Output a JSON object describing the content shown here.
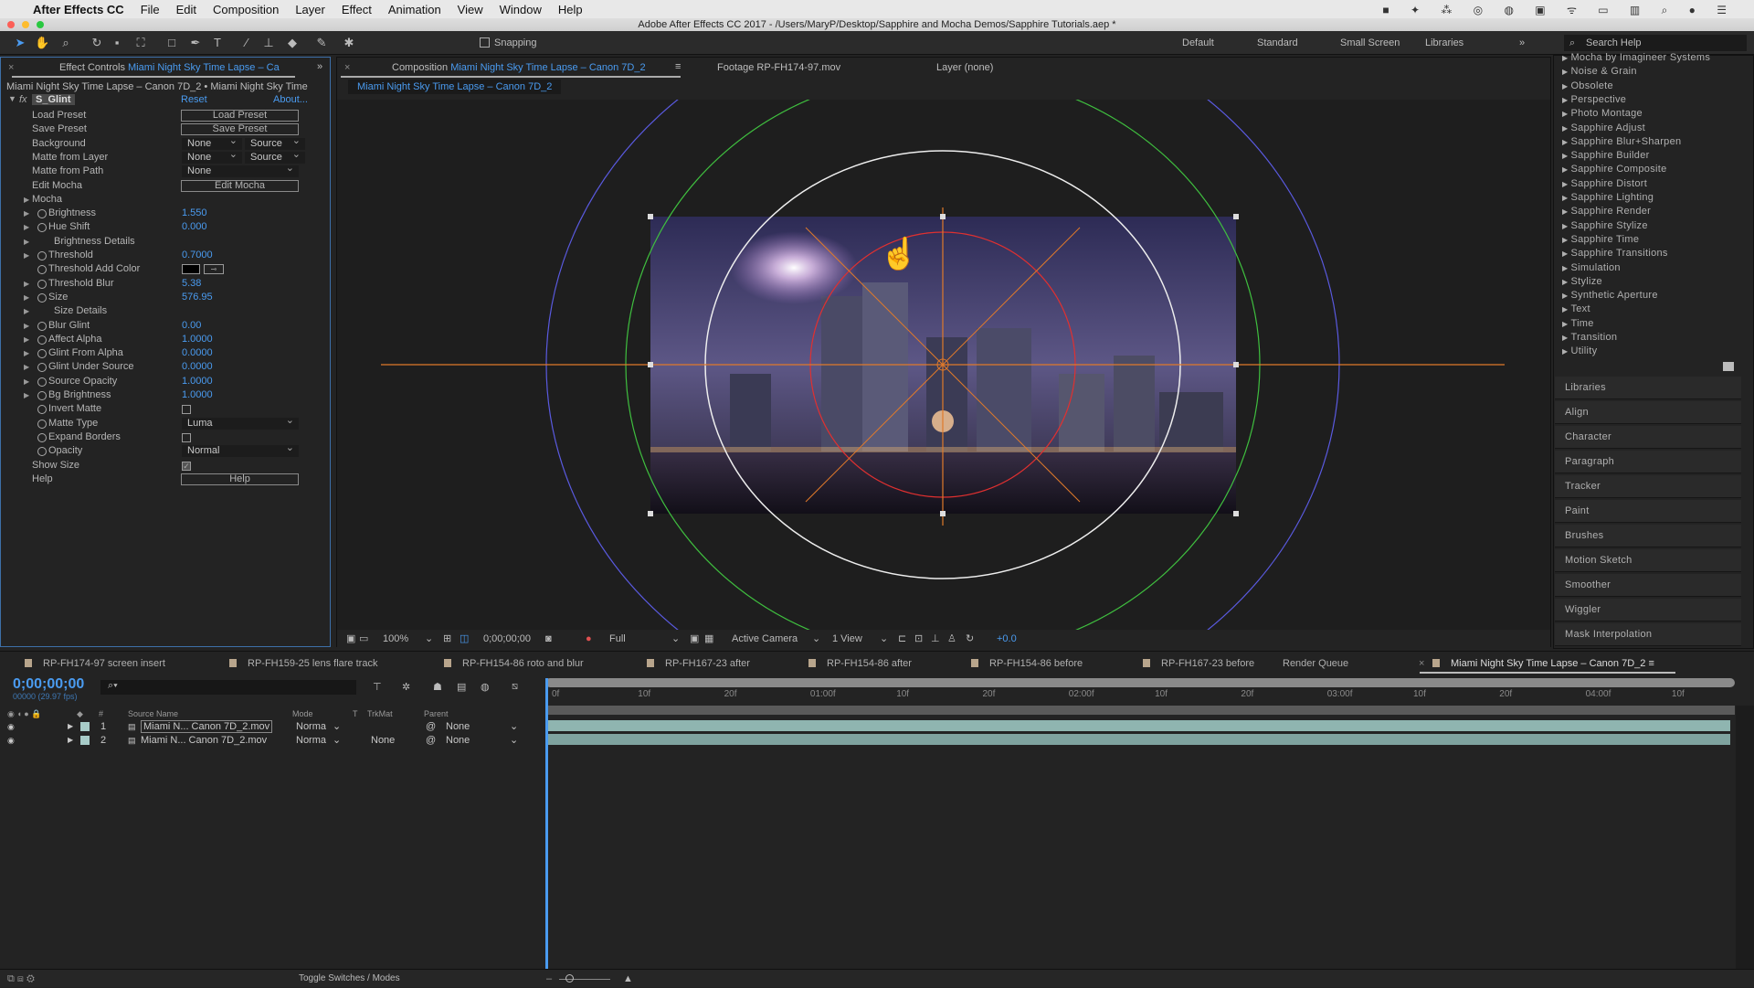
{
  "menubar": {
    "app": "After Effects CC",
    "items": [
      "File",
      "Edit",
      "Composition",
      "Layer",
      "Effect",
      "Animation",
      "View",
      "Window",
      "Help"
    ]
  },
  "titlebar": {
    "title": "Adobe After Effects CC 2017 - /Users/MaryP/Desktop/Sapphire and Mocha Demos/Sapphire Tutorials.aep *"
  },
  "toolbar": {
    "snapping": "Snapping",
    "workspaces": [
      "Default",
      "Standard",
      "Small Screen",
      "Libraries"
    ],
    "search_placeholder": "Search Help"
  },
  "effect_controls": {
    "tab_prefix": "Effect Controls",
    "tab_layer": "Miami Night Sky Time Lapse – Ca",
    "breadcrumb": "Miami Night Sky Time Lapse – Canon 7D_2 • Miami Night Sky Time",
    "effect_name": "S_Glint",
    "reset": "Reset",
    "about": "About...",
    "rows": [
      {
        "label": "Load Preset",
        "kind": "button",
        "value": "Load Preset"
      },
      {
        "label": "Save Preset",
        "kind": "button",
        "value": "Save Preset"
      },
      {
        "label": "Background",
        "kind": "dd2",
        "value": "None",
        "value2": "Source"
      },
      {
        "label": "Matte from Layer",
        "kind": "dd2",
        "value": "None",
        "value2": "Source"
      },
      {
        "label": "Matte from Path",
        "kind": "dd",
        "value": "None"
      },
      {
        "label": "Edit Mocha",
        "kind": "button",
        "value": "Edit Mocha"
      },
      {
        "label": "Mocha",
        "kind": "group",
        "twirl": true
      },
      {
        "label": "Brightness",
        "kind": "num",
        "value": "1.550",
        "twirl": true,
        "sw": true
      },
      {
        "label": "Hue Shift",
        "kind": "num",
        "value": "0.000",
        "twirl": true,
        "sw": true
      },
      {
        "label": "Brightness Details",
        "kind": "sub",
        "twirl": true
      },
      {
        "label": "Threshold",
        "kind": "num",
        "value": "0.7000",
        "twirl": true,
        "sw": true
      },
      {
        "label": "Threshold Add Color",
        "kind": "color",
        "value": "#000000",
        "sw": true
      },
      {
        "label": "Threshold Blur",
        "kind": "num",
        "value": "5.38",
        "twirl": true,
        "sw": true
      },
      {
        "label": "Size",
        "kind": "num",
        "value": "576.95",
        "twirl": true,
        "sw": true
      },
      {
        "label": "Size Details",
        "kind": "sub",
        "twirl": true
      },
      {
        "label": "Blur Glint",
        "kind": "num",
        "value": "0.00",
        "twirl": true,
        "sw": true
      },
      {
        "label": "Affect Alpha",
        "kind": "num",
        "value": "1.0000",
        "twirl": true,
        "sw": true
      },
      {
        "label": "Glint From Alpha",
        "kind": "num",
        "value": "0.0000",
        "twirl": true,
        "sw": true
      },
      {
        "label": "Glint Under Source",
        "kind": "num",
        "value": "0.0000",
        "twirl": true,
        "sw": true
      },
      {
        "label": "Source Opacity",
        "kind": "num",
        "value": "1.0000",
        "twirl": true,
        "sw": true
      },
      {
        "label": "Bg Brightness",
        "kind": "num",
        "value": "1.0000",
        "twirl": true,
        "sw": true
      },
      {
        "label": "Invert Matte",
        "kind": "check",
        "checked": false,
        "sw": true
      },
      {
        "label": "Matte Type",
        "kind": "dd",
        "value": "Luma",
        "sw": true
      },
      {
        "label": "Expand Borders",
        "kind": "check",
        "checked": false,
        "sw": true
      },
      {
        "label": "Opacity",
        "kind": "dd",
        "value": "Normal",
        "sw": true
      },
      {
        "label": "Show Size",
        "kind": "check",
        "checked": true
      },
      {
        "label": "Help",
        "kind": "button",
        "value": "Help"
      }
    ]
  },
  "composition": {
    "tab_prefix": "Composition",
    "tab_name": "Miami Night Sky Time Lapse – Canon 7D_2",
    "footage_tab": "Footage RP-FH174-97.mov",
    "layer_tab": "Layer (none)",
    "subtab": "Miami Night Sky Time Lapse – Canon 7D_2",
    "viewer_bar": {
      "zoom": "100%",
      "timecode": "0;00;00;00",
      "resolution": "Full",
      "camera": "Active Camera",
      "views": "1 View",
      "exposure": "+0.0"
    }
  },
  "effects_list": [
    "Mocha by Imagineer Systems",
    "Noise & Grain",
    "Obsolete",
    "Perspective",
    "Photo Montage",
    "Sapphire Adjust",
    "Sapphire Blur+Sharpen",
    "Sapphire Builder",
    "Sapphire Composite",
    "Sapphire Distort",
    "Sapphire Lighting",
    "Sapphire Render",
    "Sapphire Stylize",
    "Sapphire Time",
    "Sapphire Transitions",
    "Simulation",
    "Stylize",
    "Synthetic Aperture",
    "Text",
    "Time",
    "Transition",
    "Utility"
  ],
  "side_panels": [
    "Libraries",
    "Align",
    "Character",
    "Paragraph",
    "Tracker",
    "Paint",
    "Brushes",
    "Motion Sketch",
    "Smoother",
    "Wiggler",
    "Mask Interpolation"
  ],
  "timeline": {
    "tabs": [
      "RP-FH174-97 screen insert",
      "RP-FH159-25 lens flare track",
      "RP-FH154-86 roto and blur",
      "RP-FH167-23 after",
      "RP-FH154-86 after",
      "RP-FH154-86 before",
      "RP-FH167-23 before"
    ],
    "render_queue": "Render Queue",
    "active_tab": "Miami Night Sky Time Lapse – Canon 7D_2",
    "timecode": "0;00;00;00",
    "frame_info": "00000 (29.97 fps)",
    "columns": {
      "num": "#",
      "source": "Source Name",
      "mode": "Mode",
      "t": "T",
      "trkmat": "TrkMat",
      "parent": "Parent"
    },
    "layers": [
      {
        "num": "1",
        "name": "Miami N... Canon 7D_2.mov",
        "mode": "Norma",
        "trkmat": "",
        "parent": "None"
      },
      {
        "num": "2",
        "name": "Miami N... Canon 7D_2.mov",
        "mode": "Norma",
        "trkmat": "None",
        "parent": "None"
      }
    ],
    "ruler": [
      "0f",
      "10f",
      "20f",
      "01:00f",
      "10f",
      "20f",
      "02:00f",
      "10f",
      "20f",
      "03:00f",
      "10f",
      "20f",
      "04:00f",
      "10f"
    ],
    "toggle": "Toggle Switches / Modes"
  },
  "colors": {
    "accent": "#4a9bf0",
    "layer_bar": "#8fb5b0",
    "guide_orange": "#e07a2a",
    "guide_green": "#3fbf3f",
    "guide_blue": "#5a5ae0",
    "guide_red": "#e03030"
  }
}
